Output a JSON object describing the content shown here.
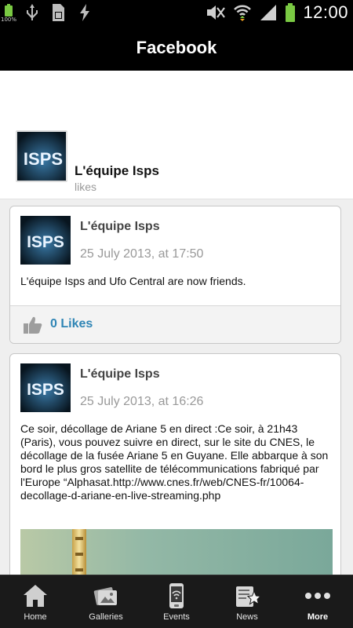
{
  "status_bar": {
    "battery_small_label": "100%",
    "time": "12:00"
  },
  "action_bar": {
    "title": "Facebook"
  },
  "page": {
    "name": "L'équipe Isps",
    "likes_label": "likes"
  },
  "posts": [
    {
      "author": "L'équipe Isps",
      "time": "25 July 2013, at 17:50",
      "text": "L'équipe Isps and Ufo Central are now friends.",
      "likes": "0 Likes"
    },
    {
      "author": "L'équipe Isps",
      "time": "25 July 2013, at 16:26",
      "text": "Ce soir, décollage de Ariane 5 en direct :Ce soir, à 21h43 (Paris), vous pouvez suivre en direct, sur le site du CNES, le décollage de la fusée Ariane 5 en Guyane. Elle abbarque à son bord le plus gros satellite de télécommunications fabriqué par l'Europe “Alphasat.http://www.cnes.fr/web/CNES-fr/10064-decollage-d-ariane-en-live-streaming.php"
    }
  ],
  "avatar_text": "ISPS",
  "bottom_nav": [
    {
      "label": "Home",
      "icon": "home-icon"
    },
    {
      "label": "Galleries",
      "icon": "galleries-icon"
    },
    {
      "label": "Events",
      "icon": "events-icon"
    },
    {
      "label": "News",
      "icon": "news-icon"
    },
    {
      "label": "More",
      "icon": "more-icon"
    }
  ],
  "colors": {
    "status_bar_bg": "#000000",
    "action_bar_bg": "#000000",
    "likes_link": "#2f85b5",
    "battery_green": "#7ac943",
    "nav_bg": "#1a1a1a"
  }
}
